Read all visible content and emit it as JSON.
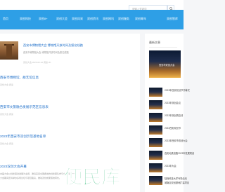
{
  "search": {
    "placeholder": "请输入关键词"
  },
  "nav": {
    "items": [
      "首页",
      "双创科技",
      "双创8+",
      "双创大会",
      "双创风采",
      "双创资讯",
      "双创网讯",
      "双创服务",
      "双创青年",
      "双创智库"
    ]
  },
  "featured": {
    "title": "西安市博物馆大会 博物馆开放时间及报名线路",
    "subtitle": "西安市博物馆大会 博物馆开放时间及报名线路",
    "meta": "双创大会 2023-02-10 阅读 2K"
  },
  "articles": [
    {
      "title": "西安市博物馆、群艺馆信息",
      "meta": "双创大会 阅读"
    },
    {
      "title": "西安市文旅融合发展示范区信息表",
      "meta": "双创大会 阅读"
    },
    {
      "title": "2023年西安市双创示范基地名单",
      "meta": "双创大会 阅读"
    },
    {
      "title": "2023双创大会开幕",
      "line1": "本届大会以创新驱动发展为主题，邀请来自全国各地的创新团队参与交流展示活动。",
      "line2": "大会期间还将举办多场论坛与项目路演，推动双创成果落地转化。"
    }
  ],
  "sidebar": {
    "title": "最新文章",
    "big_caption": "西安市双创大会",
    "items": [
      {
        "text": "2023年西安双创节开幕式"
      },
      {
        "text": "2023年双创会议"
      },
      {
        "text": "2023年双创周启动"
      },
      {
        "text": "2023西安双创节"
      },
      {
        "text": "2023年西安市双创大会"
      },
      {
        "text": "西安地铁线路2023年发展规划"
      },
      {
        "text": "2023年大会"
      },
      {
        "text": "陕西科技大学专场活动"
      },
      {
        "text": "城南区双创基地扩建项目"
      }
    ]
  },
  "watermark": {
    "text": "便民库"
  },
  "colors": {
    "nav": "#2e9fe6",
    "link": "#1d6ec9",
    "watermark": "#2bb673"
  }
}
